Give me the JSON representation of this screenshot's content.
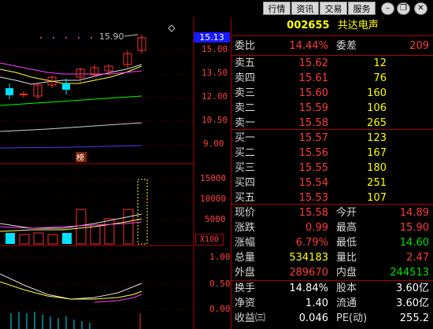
{
  "toolbar": {
    "buttons": [
      "行情",
      "资讯",
      "交易",
      "服务"
    ],
    "window_controls": [
      "minimize-icon",
      "restore-icon",
      "close-icon"
    ]
  },
  "chart": {
    "high_marker": "15.90",
    "current_price_tag": "15.13",
    "price_axis": [
      "15.00",
      "13.50",
      "12.00",
      "10.50",
      "9.00"
    ],
    "volume_axis": [
      "15000",
      "10000",
      "5000",
      "X100"
    ],
    "indicator_axis": [
      "1.00",
      "0.50",
      "0.00"
    ],
    "event_label": "榜",
    "colors": {
      "up": "#ff3030",
      "down": "#00e0ff",
      "ma_white": "#e0e0e0",
      "ma_yellow": "#ffff40",
      "ma_magenta": "#ff40ff",
      "ma_green": "#00ff00",
      "ma_blue": "#4040ff"
    }
  },
  "quote": {
    "code": "002655",
    "name": "共达电声",
    "wei_bi_label": "委比",
    "wei_bi": "14.44%",
    "wei_cha_label": "委差",
    "wei_cha": "209",
    "asks": [
      {
        "label": "卖五",
        "price": "15.62",
        "vol": "12"
      },
      {
        "label": "卖四",
        "price": "15.61",
        "vol": "76"
      },
      {
        "label": "卖三",
        "price": "15.60",
        "vol": "160"
      },
      {
        "label": "卖二",
        "price": "15.59",
        "vol": "106"
      },
      {
        "label": "卖一",
        "price": "15.58",
        "vol": "265"
      }
    ],
    "bids": [
      {
        "label": "买一",
        "price": "15.57",
        "vol": "123"
      },
      {
        "label": "买二",
        "price": "15.56",
        "vol": "167"
      },
      {
        "label": "买三",
        "price": "15.55",
        "vol": "180"
      },
      {
        "label": "买四",
        "price": "15.54",
        "vol": "251"
      },
      {
        "label": "买五",
        "price": "15.53",
        "vol": "107"
      }
    ],
    "stats": [
      {
        "l1": "现价",
        "v1": "15.58",
        "l2": "今开",
        "v2": "14.89"
      },
      {
        "l1": "涨跌",
        "v1": "0.99",
        "l2": "最高",
        "v2": "15.90"
      },
      {
        "l1": "涨幅",
        "v1": "6.79%",
        "l2": "最低",
        "v2": "14.60"
      },
      {
        "l1": "总量",
        "v1": "534183",
        "l2": "量比",
        "v2": "2.47"
      },
      {
        "l1": "外盘",
        "v1": "289670",
        "l2": "内盘",
        "v2": "244513"
      }
    ],
    "extra": [
      {
        "l1": "换手",
        "v1": "14.84%",
        "l2": "股本",
        "v2": "3.60亿"
      },
      {
        "l1": "净资",
        "v1": "1.40",
        "l2": "流通",
        "v2": "3.60亿"
      },
      {
        "l1": "收益㈢",
        "v1": "0.046",
        "l2": "PE(动)",
        "v2": "255.2"
      }
    ]
  }
}
